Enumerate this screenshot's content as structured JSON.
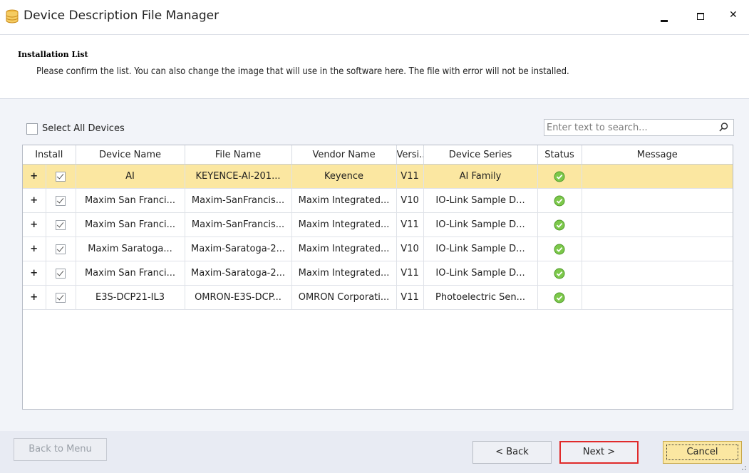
{
  "window": {
    "title": "Device Description File Manager",
    "icon": "database-icon"
  },
  "header": {
    "section_title": "Installation List",
    "description": "Please confirm the list. You can also change the image that will use in the software here. The file with error will not be installed."
  },
  "toolbar": {
    "select_all_label": "Select All Devices",
    "select_all_checked": false,
    "search_placeholder": "Enter text to search..."
  },
  "grid": {
    "columns": [
      "Install",
      "Device Name",
      "File Name",
      "Vendor Name",
      "Versi...",
      "Device Series",
      "Status",
      "Message"
    ],
    "rows": [
      {
        "expand": "+",
        "install": true,
        "device_name": "AI",
        "file_name": "KEYENCE-AI-201...",
        "vendor": "Keyence",
        "version": "V11",
        "series": "AI Family",
        "status": "ok",
        "message": "",
        "selected": true
      },
      {
        "expand": "+",
        "install": true,
        "device_name": "Maxim San Franci...",
        "file_name": "Maxim-SanFrancis...",
        "vendor": "Maxim Integrated...",
        "version": "V10",
        "series": "IO-Link Sample D...",
        "status": "ok",
        "message": "",
        "selected": false
      },
      {
        "expand": "+",
        "install": true,
        "device_name": "Maxim San Franci...",
        "file_name": "Maxim-SanFrancis...",
        "vendor": "Maxim Integrated...",
        "version": "V11",
        "series": "IO-Link Sample D...",
        "status": "ok",
        "message": "",
        "selected": false
      },
      {
        "expand": "+",
        "install": true,
        "device_name": "Maxim Saratoga...",
        "file_name": "Maxim-Saratoga-2...",
        "vendor": "Maxim Integrated...",
        "version": "V10",
        "series": "IO-Link Sample D...",
        "status": "ok",
        "message": "",
        "selected": false
      },
      {
        "expand": "+",
        "install": true,
        "device_name": "Maxim San Franci...",
        "file_name": "Maxim-Saratoga-2...",
        "vendor": "Maxim Integrated...",
        "version": "V11",
        "series": "IO-Link Sample D...",
        "status": "ok",
        "message": "",
        "selected": false
      },
      {
        "expand": "+",
        "install": true,
        "device_name": "E3S-DCP21-IL3",
        "file_name": "OMRON-E3S-DCP...",
        "vendor": "OMRON Corporati...",
        "version": "V11",
        "series": "Photoelectric Sen...",
        "status": "ok",
        "message": "",
        "selected": false
      }
    ]
  },
  "footer": {
    "back_to_menu": "Back to Menu",
    "back": "< Back",
    "next": "Next >",
    "cancel": "Cancel"
  },
  "colors": {
    "selected_row": "#fbe7a1",
    "highlight_border": "#e02a2a",
    "status_ok": "#6fbf3a",
    "content_bg": "#f2f4f9"
  }
}
